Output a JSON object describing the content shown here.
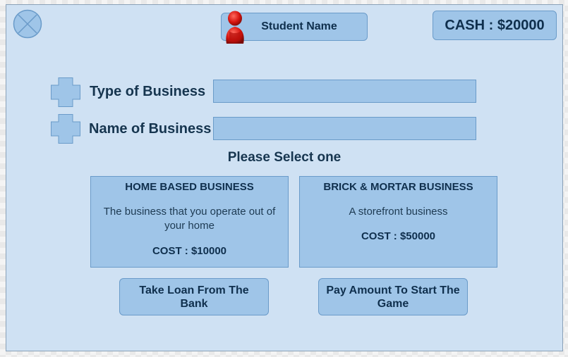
{
  "header": {
    "student_label": "Student Name",
    "cash_label": "CASH : $20000"
  },
  "form": {
    "fields": [
      {
        "label": "Type of Business",
        "value": ""
      },
      {
        "label": "Name of Business",
        "value": ""
      }
    ],
    "prompt": "Please Select one"
  },
  "options": [
    {
      "title": "HOME BASED BUSINESS",
      "description": "The business that you operate out of your home",
      "cost": "COST : $10000"
    },
    {
      "title": "BRICK & MORTAR BUSINESS",
      "description": "A storefront business",
      "cost": "COST : $50000"
    }
  ],
  "actions": {
    "loan_label": "Take Loan From The Bank",
    "pay_label": "Pay Amount To Start The Game"
  },
  "icons": {
    "close": "close-circle-icon",
    "avatar": "student-avatar-icon",
    "add": "plus-icon"
  },
  "colors": {
    "background": "#cfe1f3",
    "panel": "#9fc5e8",
    "border": "#6a9bc9",
    "text": "#0f2f4d",
    "avatar": "#d6140f"
  }
}
